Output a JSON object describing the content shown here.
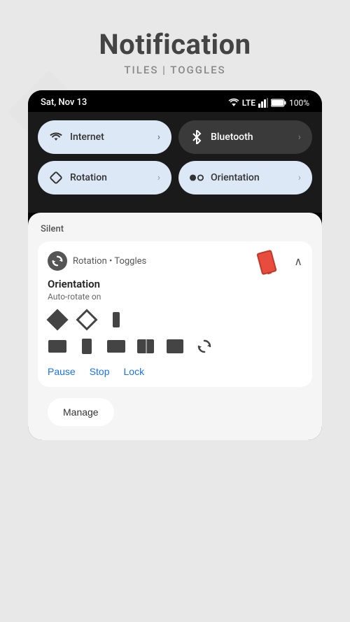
{
  "page": {
    "title": "Notification",
    "subtitle": "TILES | TOGGLES"
  },
  "status_bar": {
    "time": "Sat, Nov 13",
    "signal": "LTE",
    "battery": "100%"
  },
  "tiles": {
    "row1": [
      {
        "id": "internet",
        "label": "Internet",
        "theme": "light"
      },
      {
        "id": "bluetooth",
        "label": "Bluetooth",
        "theme": "dark"
      }
    ],
    "row2": [
      {
        "id": "rotation",
        "label": "Rotation",
        "theme": "light"
      },
      {
        "id": "orientation",
        "label": "Orientation",
        "theme": "light"
      }
    ]
  },
  "notification": {
    "section_label": "Silent",
    "app_name": "Rotation • Toggles",
    "title": "Orientation",
    "subtitle": "Auto-rotate on",
    "actions": {
      "pause": "Pause",
      "stop": "Stop",
      "lock": "Lock"
    }
  },
  "manage_button": "Manage",
  "icons": {
    "chevron_right": "›",
    "expand_up": "^",
    "wifi": "wifi",
    "bluetooth": "bluetooth",
    "rotation": "rotation",
    "orientation": "orientation"
  }
}
